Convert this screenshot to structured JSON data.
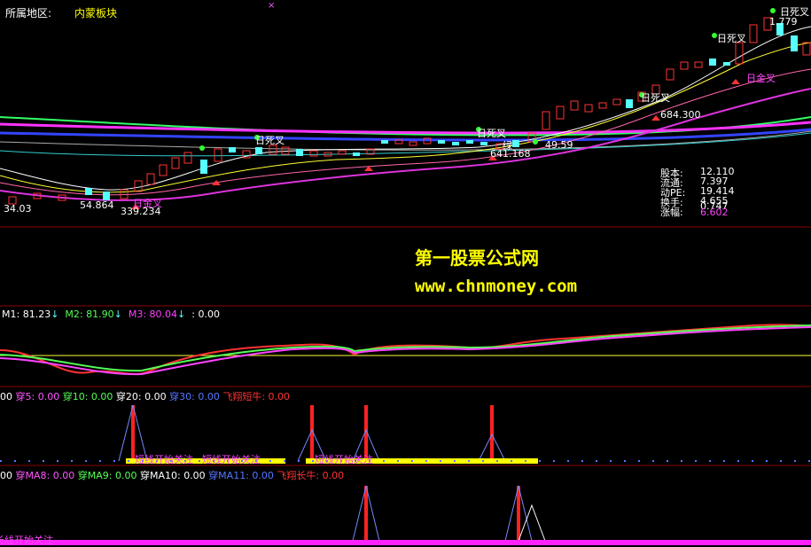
{
  "header": {
    "region_label": "所属地区:",
    "sector": "内蒙板块"
  },
  "main_chart": {
    "price_labels": [
      "1.779",
      "684.300",
      "641.168",
      "339.234",
      "54.864",
      "34.03"
    ],
    "annotations": {
      "cross_death": "日死叉",
      "cross_gold": "日金叉",
      "signal_a": "绿",
      "signal_b": "49.59"
    },
    "stats": {
      "labels": [
        "股本:",
        "流通:",
        "动PE:",
        "换手:",
        "涨幅:"
      ],
      "values": [
        "12.110",
        "7.397",
        "19.414",
        "4.655",
        "0.747",
        "6.602"
      ]
    }
  },
  "watermark": {
    "title": "第一股票公式网",
    "url": "www.chnmoney.com"
  },
  "panel_m": {
    "m1_label": "M1:",
    "m1_value": "81.23",
    "m1_arrow": "↓",
    "m2_label": "M2:",
    "m2_value": "81.90",
    "m2_arrow": "↓",
    "m3_label": "M3:",
    "m3_value": "80.04",
    "m3_arrow": "↓",
    "m4_label": ":",
    "m4_value": "0.00"
  },
  "panel_short": {
    "prefix": "00",
    "items": [
      {
        "label": "穿5:",
        "value": "0.00",
        "color": "#ff55ff"
      },
      {
        "label": "穿10:",
        "value": "0.00",
        "color": "#55ff55"
      },
      {
        "label": "穿20:",
        "value": "0.00",
        "color": "#ffffff"
      },
      {
        "label": "穿30:",
        "value": "0.00",
        "color": "#5577ff"
      },
      {
        "label": "飞翔短牛:",
        "value": "0.00",
        "color": "#ff3333"
      }
    ],
    "focus_labels": [
      "短线开始关注",
      "短线开始关注",
      "短线开始关注"
    ]
  },
  "panel_long": {
    "prefix": "00",
    "items": [
      {
        "label": "穿MA8:",
        "value": "0.00",
        "color": "#ff55ff"
      },
      {
        "label": "穿MA9:",
        "value": "0.00",
        "color": "#55ff55"
      },
      {
        "label": "穿MA10:",
        "value": "0.00",
        "color": "#ffffff"
      },
      {
        "label": "穿MA11:",
        "value": "0.00",
        "color": "#5577ff"
      },
      {
        "label": "飞翔长牛:",
        "value": "0.00",
        "color": "#ff3333"
      }
    ],
    "focus_label": "长线开始关注"
  },
  "colors": {
    "background": "#000000",
    "divider": "#8b0000",
    "up": "#ff3333",
    "down": "#55ffff",
    "label": "#ffff00"
  }
}
